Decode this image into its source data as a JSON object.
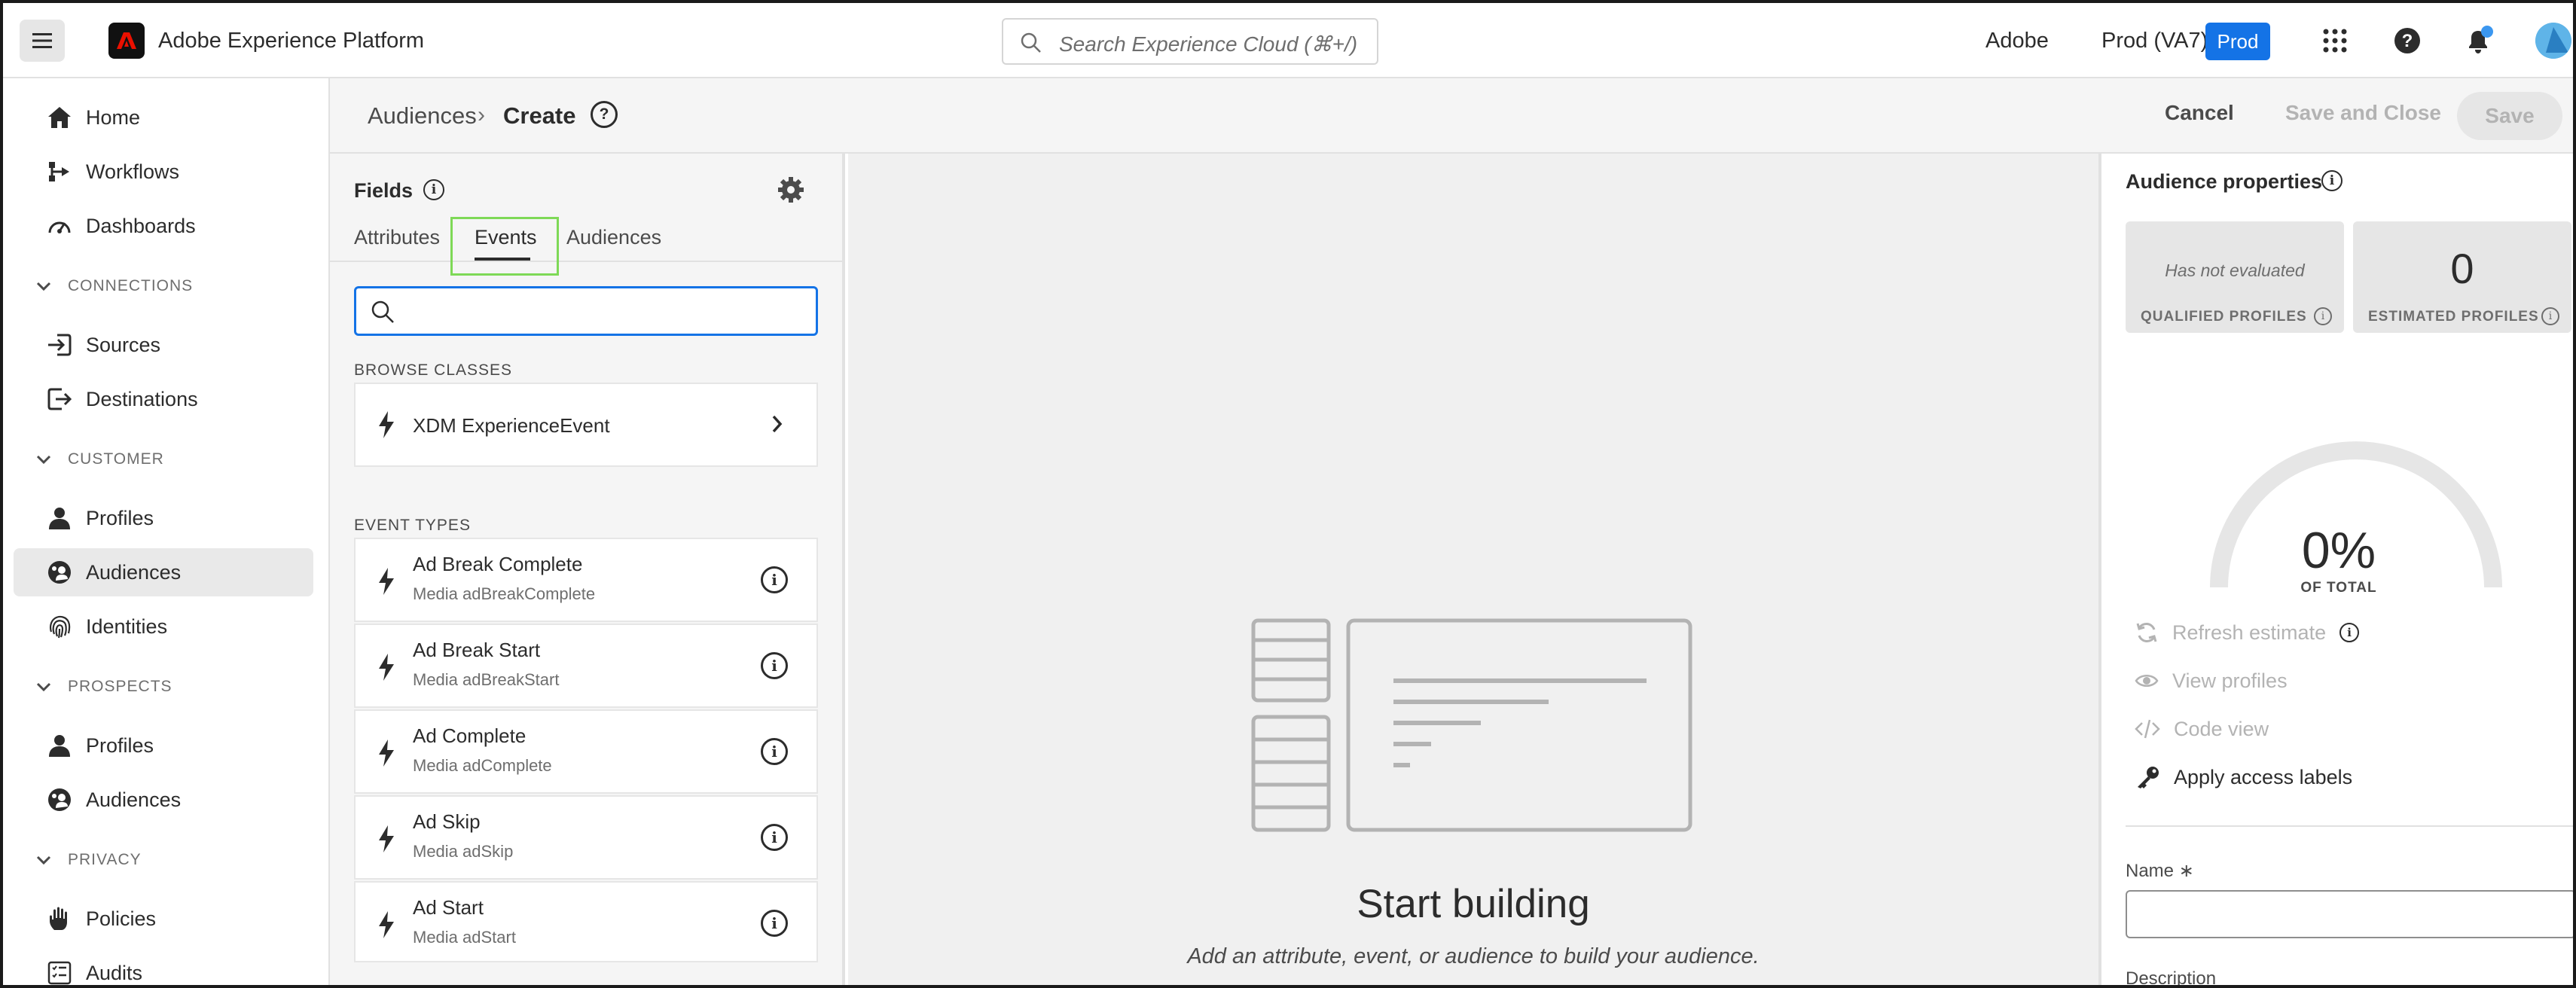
{
  "app": {
    "title": "Adobe Experience Platform"
  },
  "search": {
    "placeholder": "Search Experience Cloud (⌘+/)"
  },
  "header_right": {
    "org": "Adobe",
    "sandbox": "Prod (VA7)",
    "env_badge": "Prod"
  },
  "sidebar": {
    "home": "Home",
    "workflows": "Workflows",
    "dashboards": "Dashboards",
    "sections": {
      "connections": "CONNECTIONS",
      "customer": "CUSTOMER",
      "prospects": "PROSPECTS",
      "privacy": "PRIVACY"
    },
    "sources": "Sources",
    "destinations": "Destinations",
    "customer_profiles": "Profiles",
    "customer_audiences": "Audiences",
    "identities": "Identities",
    "prospect_profiles": "Profiles",
    "prospect_audiences": "Audiences",
    "policies": "Policies",
    "audits": "Audits",
    "active_item": "customer_audiences"
  },
  "page_header": {
    "breadcrumb_root": "Audiences",
    "breadcrumb_separator": "›",
    "breadcrumb_current": "Create",
    "cancel": "Cancel",
    "save_and_close": "Save and Close",
    "save": "Save"
  },
  "fields_panel": {
    "title": "Fields",
    "tabs": [
      "Attributes",
      "Events",
      "Audiences"
    ],
    "active_tab": "Events",
    "browse_classes_label": "BROWSE CLASSES",
    "browse_classes": [
      {
        "name": "XDM ExperienceEvent"
      }
    ],
    "event_types_label": "EVENT TYPES",
    "event_types": [
      {
        "name": "Ad Break Complete",
        "sub": "Media adBreakComplete"
      },
      {
        "name": "Ad Break Start",
        "sub": "Media adBreakStart"
      },
      {
        "name": "Ad Complete",
        "sub": "Media adComplete"
      },
      {
        "name": "Ad Skip",
        "sub": "Media adSkip"
      },
      {
        "name": "Ad Start",
        "sub": "Media adStart"
      }
    ]
  },
  "canvas": {
    "title": "Start building",
    "subtitle": "Add an attribute, event, or audience to build your audience."
  },
  "properties": {
    "title": "Audience properties",
    "qualified": {
      "value": "Has not evaluated",
      "label": "QUALIFIED PROFILES"
    },
    "estimated": {
      "value": "0",
      "label": "ESTIMATED PROFILES"
    },
    "gauge": {
      "percent": "0%",
      "label": "OF TOTAL",
      "fraction": 0
    },
    "actions": {
      "refresh": "Refresh estimate",
      "view_profiles": "View profiles",
      "code_view": "Code view",
      "apply_labels": "Apply access labels"
    },
    "name_label": "Name",
    "required_mark": "∗",
    "description_label": "Description"
  },
  "colors": {
    "accent_blue": "#1473e6",
    "tab_highlight": "#7ed957",
    "adobe_red": "#eb1000"
  },
  "icons": [
    "hamburger-icon",
    "adobe-logo-icon",
    "search-icon",
    "apps-grid-icon",
    "help-icon",
    "bell-icon",
    "home-icon",
    "workflows-icon",
    "dashboards-icon",
    "chevron-down-icon",
    "sources-icon",
    "destinations-icon",
    "person-icon",
    "audiences-icon",
    "fingerprint-icon",
    "hand-icon",
    "audits-icon",
    "info-icon",
    "gear-icon",
    "bolt-icon",
    "chevron-right-icon",
    "refresh-icon",
    "eye-icon",
    "code-icon",
    "key-icon"
  ]
}
